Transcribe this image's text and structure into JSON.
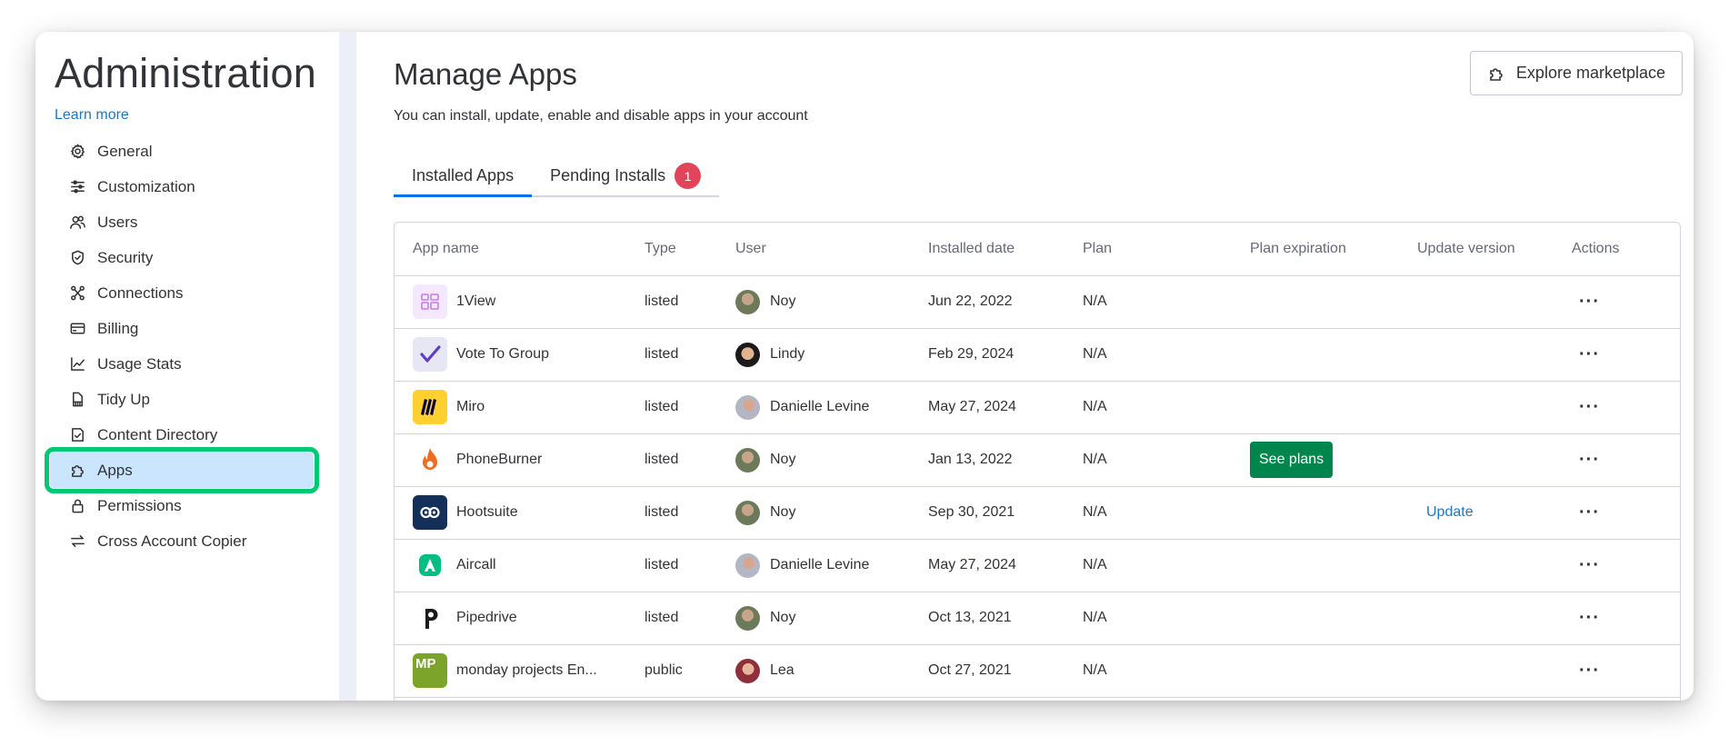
{
  "sidebar": {
    "title": "Administration",
    "learn_more": "Learn more",
    "items": [
      {
        "label": "General",
        "icon": "gear-icon"
      },
      {
        "label": "Customization",
        "icon": "sliders-icon"
      },
      {
        "label": "Users",
        "icon": "users-icon"
      },
      {
        "label": "Security",
        "icon": "shield-icon"
      },
      {
        "label": "Connections",
        "icon": "connections-icon"
      },
      {
        "label": "Billing",
        "icon": "credit-card-icon"
      },
      {
        "label": "Usage Stats",
        "icon": "chart-icon"
      },
      {
        "label": "Tidy Up",
        "icon": "broom-icon"
      },
      {
        "label": "Content Directory",
        "icon": "content-directory-icon"
      },
      {
        "label": "Apps",
        "icon": "puzzle-icon",
        "active": true
      },
      {
        "label": "Permissions",
        "icon": "lock-icon"
      },
      {
        "label": "Cross Account Copier",
        "icon": "swap-arrows-icon"
      }
    ],
    "active_highlight_color": "#00c875"
  },
  "main": {
    "title": "Manage Apps",
    "subtitle": "You can install, update, enable and disable apps in your account",
    "explore_button": "Explore marketplace",
    "tabs": [
      {
        "label": "Installed Apps",
        "active": true
      },
      {
        "label": "Pending Installs",
        "badge": "1"
      }
    ],
    "table": {
      "columns": [
        "App name",
        "Type",
        "User",
        "Installed date",
        "Plan",
        "Plan expiration",
        "Update version",
        "Actions"
      ],
      "rows": [
        {
          "app": "1View",
          "logo": "1view-logo",
          "type": "listed",
          "user": "Noy",
          "date": "Jun 22, 2022",
          "plan": "N/A",
          "plan_expiration": "",
          "update": "",
          "actions": "···"
        },
        {
          "app": "Vote To Group",
          "logo": "vote-to-group-logo",
          "type": "listed",
          "user": "Lindy",
          "date": "Feb 29, 2024",
          "plan": "N/A",
          "plan_expiration": "",
          "update": "",
          "actions": "···"
        },
        {
          "app": "Miro",
          "logo": "miro-logo",
          "type": "listed",
          "user": "Danielle Levine",
          "date": "May 27, 2024",
          "plan": "N/A",
          "plan_expiration": "",
          "update": "",
          "actions": "···"
        },
        {
          "app": "PhoneBurner",
          "logo": "phoneburner-logo",
          "type": "listed",
          "user": "Noy",
          "date": "Jan 13, 2022",
          "plan": "N/A",
          "plan_expiration": "See plans",
          "update": "",
          "actions": "···"
        },
        {
          "app": "Hootsuite",
          "logo": "hootsuite-logo",
          "type": "listed",
          "user": "Noy",
          "date": "Sep 30, 2021",
          "plan": "N/A",
          "plan_expiration": "",
          "update": "Update",
          "actions": "···"
        },
        {
          "app": "Aircall",
          "logo": "aircall-logo",
          "type": "listed",
          "user": "Danielle Levine",
          "date": "May 27, 2024",
          "plan": "N/A",
          "plan_expiration": "",
          "update": "",
          "actions": "···"
        },
        {
          "app": "Pipedrive",
          "logo": "pipedrive-logo",
          "type": "listed",
          "user": "Noy",
          "date": "Oct 13, 2021",
          "plan": "N/A",
          "plan_expiration": "",
          "update": "",
          "actions": "···"
        },
        {
          "app": "monday projects En...",
          "logo": "monday-projects-logo",
          "logo_text": "MP",
          "type": "public",
          "user": "Lea",
          "date": "Oct 27, 2021",
          "plan": "N/A",
          "plan_expiration": "",
          "update": "",
          "actions": "···"
        }
      ]
    }
  },
  "colors": {
    "link": "#1f76c2",
    "primary": "#0073ea",
    "badge": "#e2445c",
    "see_plans": "#00854d",
    "active_nav_bg": "#cce5ff"
  }
}
